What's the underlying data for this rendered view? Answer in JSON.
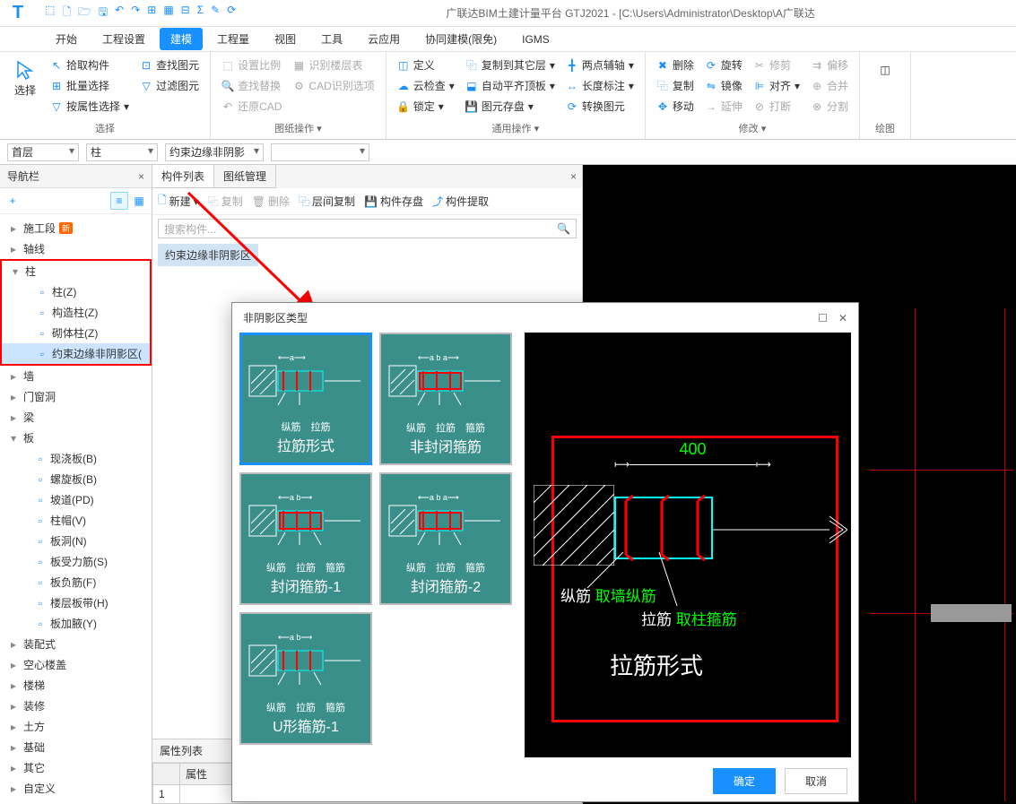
{
  "title": "广联达BIM土建计量平台 GTJ2021 - [C:\\Users\\Administrator\\Desktop\\A广联达",
  "menu": {
    "items": [
      "开始",
      "工程设置",
      "建模",
      "工程量",
      "视图",
      "工具",
      "云应用",
      "协同建模(限免)",
      "IGMS"
    ],
    "active": 2
  },
  "ribbon": {
    "select": {
      "label": "选择",
      "main": "选择",
      "items": [
        "拾取构件",
        "批量选择",
        "按属性选择"
      ],
      "right": [
        "查找图元",
        "过滤图元"
      ]
    },
    "paper": {
      "label": "图纸操作",
      "items1": [
        "设置比例",
        "查找替换",
        "还原CAD"
      ],
      "items2": [
        "识别楼层表",
        "CAD识别选项"
      ]
    },
    "common": {
      "label": "通用操作",
      "row1": [
        "定义",
        "云检查",
        "锁定"
      ],
      "row2": [
        "复制到其它层",
        "自动平齐顶板",
        "图元存盘"
      ],
      "row3": [
        "两点辅轴",
        "长度标注",
        "转换图元"
      ]
    },
    "modify": {
      "label": "修改",
      "col1": [
        "删除",
        "复制",
        "移动"
      ],
      "col2": [
        "旋转",
        "镜像",
        "延伸"
      ],
      "col3": [
        "修剪",
        "对齐",
        "打断"
      ],
      "col4": [
        "偏移",
        "合并",
        "分割"
      ]
    },
    "draw": {
      "label": "绘图"
    }
  },
  "selectors": {
    "floor": "首层",
    "type": "柱",
    "sub": "约束边缘非阴影"
  },
  "nav": {
    "title": "导航栏",
    "groups": [
      {
        "label": "施工段",
        "badge": "新"
      },
      {
        "label": "轴线"
      },
      {
        "label": "柱",
        "expanded": true,
        "boxed": true,
        "children": [
          {
            "label": "柱(Z)",
            "icon": "column"
          },
          {
            "label": "构造柱(Z)",
            "icon": "construct"
          },
          {
            "label": "砌体柱(Z)",
            "icon": "masonry"
          },
          {
            "label": "约束边缘非阴影区(",
            "icon": "edge",
            "selected": true
          }
        ]
      },
      {
        "label": "墙"
      },
      {
        "label": "门窗洞"
      },
      {
        "label": "梁"
      },
      {
        "label": "板",
        "expanded": true,
        "children": [
          {
            "label": "现浇板(B)",
            "icon": "slab"
          },
          {
            "label": "螺旋板(B)",
            "icon": "spiral"
          },
          {
            "label": "坡道(PD)",
            "icon": "ramp"
          },
          {
            "label": "柱帽(V)",
            "icon": "cap"
          },
          {
            "label": "板洞(N)",
            "icon": "hole"
          },
          {
            "label": "板受力筋(S)",
            "icon": "rebar1"
          },
          {
            "label": "板负筋(F)",
            "icon": "rebar2"
          },
          {
            "label": "楼层板带(H)",
            "icon": "strip"
          },
          {
            "label": "板加腋(Y)",
            "icon": "haunch"
          }
        ]
      },
      {
        "label": "装配式"
      },
      {
        "label": "空心楼盖"
      },
      {
        "label": "楼梯"
      },
      {
        "label": "装修"
      },
      {
        "label": "土方"
      },
      {
        "label": "基础"
      },
      {
        "label": "其它"
      },
      {
        "label": "自定义"
      }
    ]
  },
  "mid": {
    "tabs": [
      "构件列表",
      "图纸管理"
    ],
    "toolbar": {
      "new": "新建",
      "copy": "复制",
      "delete": "删除",
      "layer_copy": "层间复制",
      "save": "构件存盘",
      "extract": "构件提取"
    },
    "search_ph": "搜索构件...",
    "item": "约束边缘非阴影区",
    "attr_title": "属性列表",
    "attr_col": "属性"
  },
  "modal": {
    "title": "非阴影区类型",
    "tiles": [
      {
        "title": "拉筋形式",
        "labels": [
          "纵筋",
          "拉筋"
        ],
        "dims": "a",
        "selected": true,
        "type": "tie"
      },
      {
        "title": "非封闭箍筋",
        "labels": [
          "纵筋",
          "拉筋",
          "箍筋"
        ],
        "dims": "a b a",
        "type": "open"
      },
      {
        "title": "封闭箍筋-1",
        "labels": [
          "纵筋",
          "拉筋",
          "箍筋"
        ],
        "dims": "a b",
        "type": "closed1"
      },
      {
        "title": "封闭箍筋-2",
        "labels": [
          "纵筋",
          "拉筋",
          "箍筋"
        ],
        "dims": "a b a",
        "type": "closed2"
      },
      {
        "title": "U形箍筋-1",
        "labels": [
          "纵筋",
          "拉筋",
          "箍筋"
        ],
        "dims": "a b",
        "type": "u1"
      }
    ],
    "preview": {
      "dim": "400",
      "l_zong": "纵筋",
      "l_zong_v": "取墙纵筋",
      "l_la": "拉筋",
      "l_la_v": "取柱箍筋",
      "title": "拉筋形式"
    },
    "ok": "确定",
    "cancel": "取消"
  }
}
